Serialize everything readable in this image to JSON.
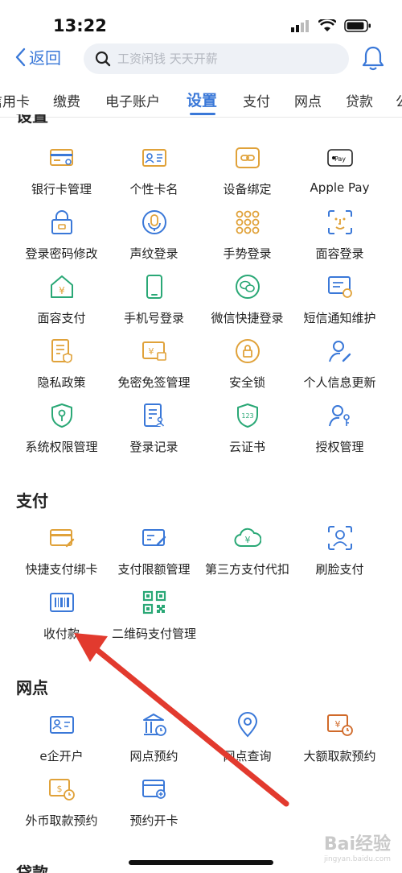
{
  "status_bar": {
    "time": "13:22"
  },
  "header": {
    "back_label": "返回",
    "search_placeholder": "工资闲钱 天天开薪"
  },
  "tabs": [
    "信用卡",
    "缴费",
    "电子账户",
    "设置",
    "支付",
    "网点",
    "贷款"
  ],
  "settings": {
    "title": "设置",
    "items": [
      "银行卡管理",
      "个性卡名",
      "设备绑定",
      "Apple Pay",
      "登录密码修改",
      "声纹登录",
      "手势登录",
      "面容登录",
      "面容支付",
      "手机号登录",
      "微信快捷登录",
      "短信通知维护",
      "隐私政策",
      "免密免签管理",
      "安全锁",
      "个人信息更新",
      "系统权限管理",
      "登录记录",
      "云证书",
      "授权管理"
    ]
  },
  "payment": {
    "title": "支付",
    "items": [
      "快捷支付绑卡",
      "支付限额管理",
      "第三方支付代扣",
      "刷脸支付",
      "收付款",
      "二维码支付管理"
    ]
  },
  "branch": {
    "title": "网点",
    "items": [
      "e企开户",
      "网点预约",
      "网点查询",
      "大额取款预约",
      "外币取款预约",
      "预约开卡"
    ]
  },
  "loan": {
    "title": "贷款"
  },
  "watermark": {
    "brand": "Bai经验",
    "url": "jingyan.baidu.com"
  },
  "colors": {
    "accent": "#3a78d8",
    "icon_orange": "#e0a23a",
    "icon_green": "#2aa876",
    "arrow_red": "#e23a2e"
  }
}
